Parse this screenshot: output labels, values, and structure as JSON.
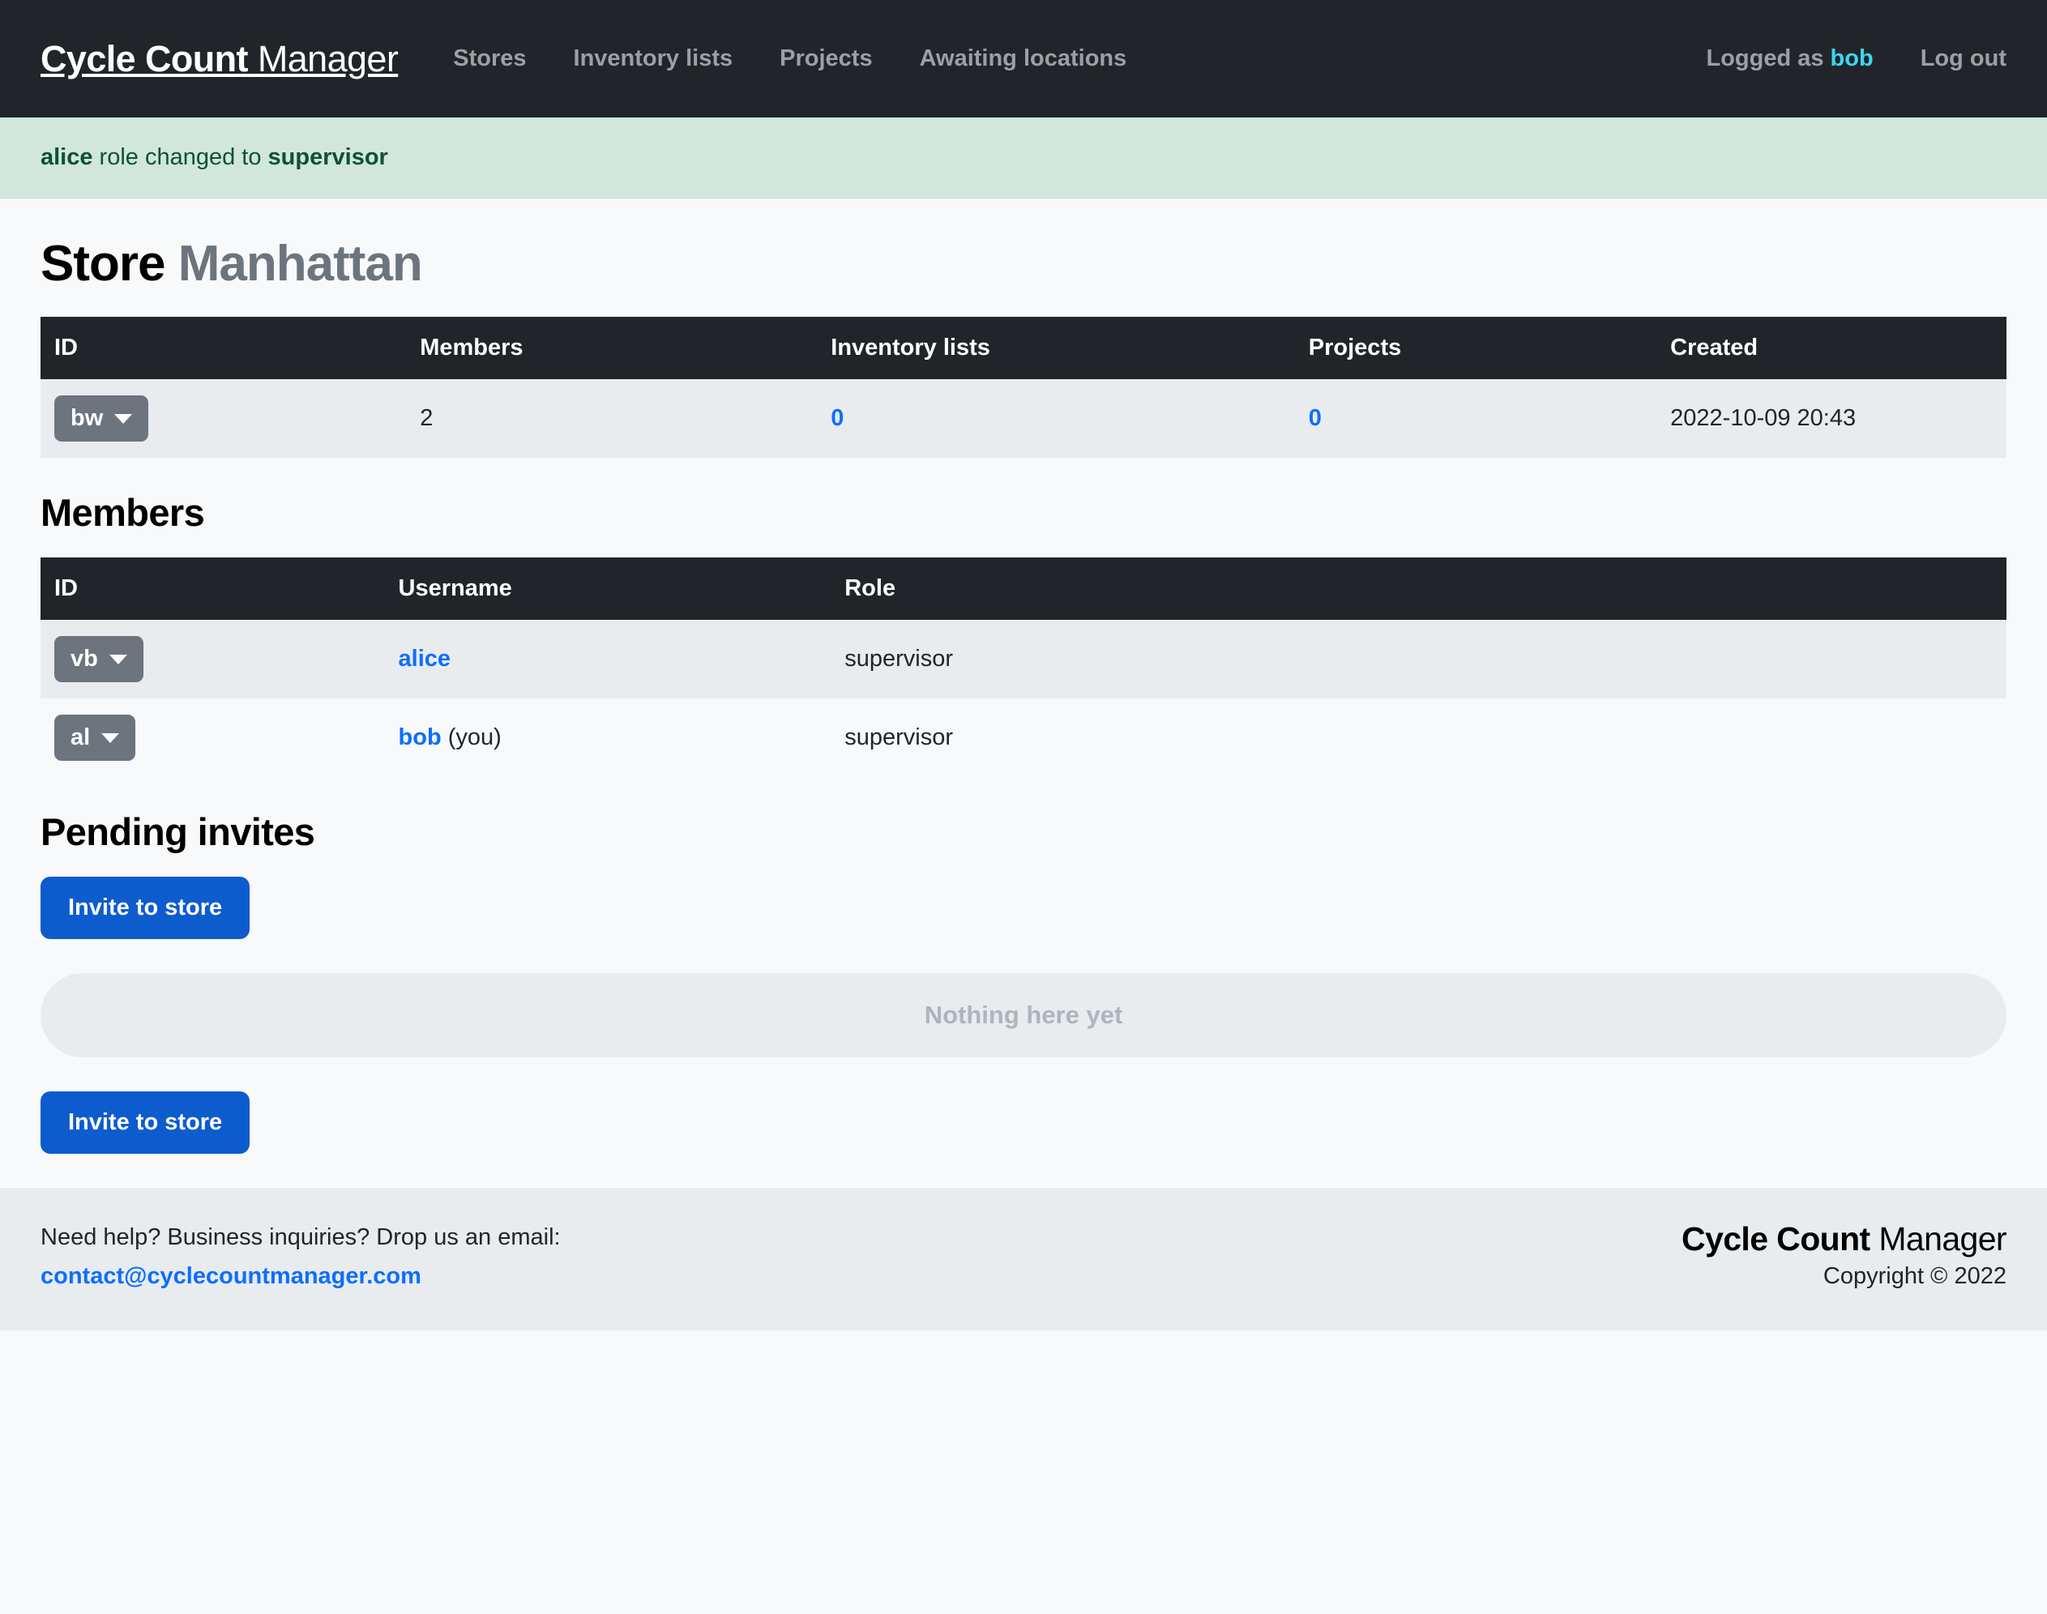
{
  "navbar": {
    "brand_strong": "Cycle Count",
    "brand_light": " Manager",
    "links": [
      {
        "label": "Stores"
      },
      {
        "label": "Inventory lists"
      },
      {
        "label": "Projects"
      },
      {
        "label": "Awaiting locations"
      }
    ],
    "logged_as_prefix": "Logged as ",
    "logged_as_user": "bob",
    "logout_label": "Log out",
    "accent_user_color": "#3dd5f3"
  },
  "alert": {
    "subject": "alice",
    "middle": " role changed to ",
    "value": "supervisor",
    "bg_color": "#d1e7dd",
    "text_color": "#0f5132"
  },
  "page": {
    "title_strong": "Store",
    "title_muted": "Manhattan"
  },
  "store_table": {
    "headers": [
      "ID",
      "Members",
      "Inventory lists",
      "Projects",
      "Created"
    ],
    "row": {
      "id": "bw",
      "members": "2",
      "inventory_lists": "0",
      "projects": "0",
      "created": "2022-10-09 20:43"
    }
  },
  "members_section": {
    "title": "Members",
    "headers": [
      "ID",
      "Username",
      "Role"
    ],
    "rows": [
      {
        "id": "vb",
        "username": "alice",
        "username_suffix": "",
        "role": "supervisor"
      },
      {
        "id": "al",
        "username": "bob",
        "username_suffix": " (you)",
        "role": "supervisor"
      }
    ]
  },
  "pending_invites": {
    "title": "Pending invites",
    "invite_button_top": "Invite to store",
    "empty_text": "Nothing here yet",
    "invite_button_bottom": "Invite to store",
    "button_color": "#0d5ccd"
  },
  "footer": {
    "help_text": "Need help? Business inquiries? Drop us an email:",
    "email": "contact@cyclecountmanager.com",
    "brand_strong": "Cycle Count",
    "brand_light": " Manager",
    "copyright": "Copyright © 2022"
  }
}
